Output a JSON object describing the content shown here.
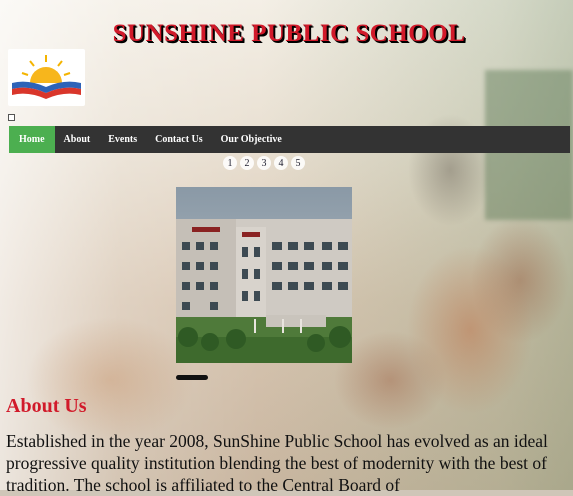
{
  "header": {
    "title": "SUNSHINE PUBLIC SCHOOL"
  },
  "logo": {
    "icon": "sun-book-logo"
  },
  "nav": {
    "items": [
      {
        "label": "Home",
        "active": true
      },
      {
        "label": "About"
      },
      {
        "label": "Events"
      },
      {
        "label": "Contact Us"
      },
      {
        "label": "Our Objective"
      }
    ]
  },
  "slider": {
    "pages": [
      "1",
      "2",
      "3",
      "4",
      "5"
    ]
  },
  "about": {
    "heading": "About Us",
    "text": "Established in the year 2008, SunShine Public School has evolved as an ideal progressive quality institution blending the best of modernity with the best of tradition. The school is affiliated to the Central Board of"
  },
  "colors": {
    "title_red": "#d11a2a",
    "nav_bg": "#333333",
    "nav_active": "#4caf50"
  }
}
